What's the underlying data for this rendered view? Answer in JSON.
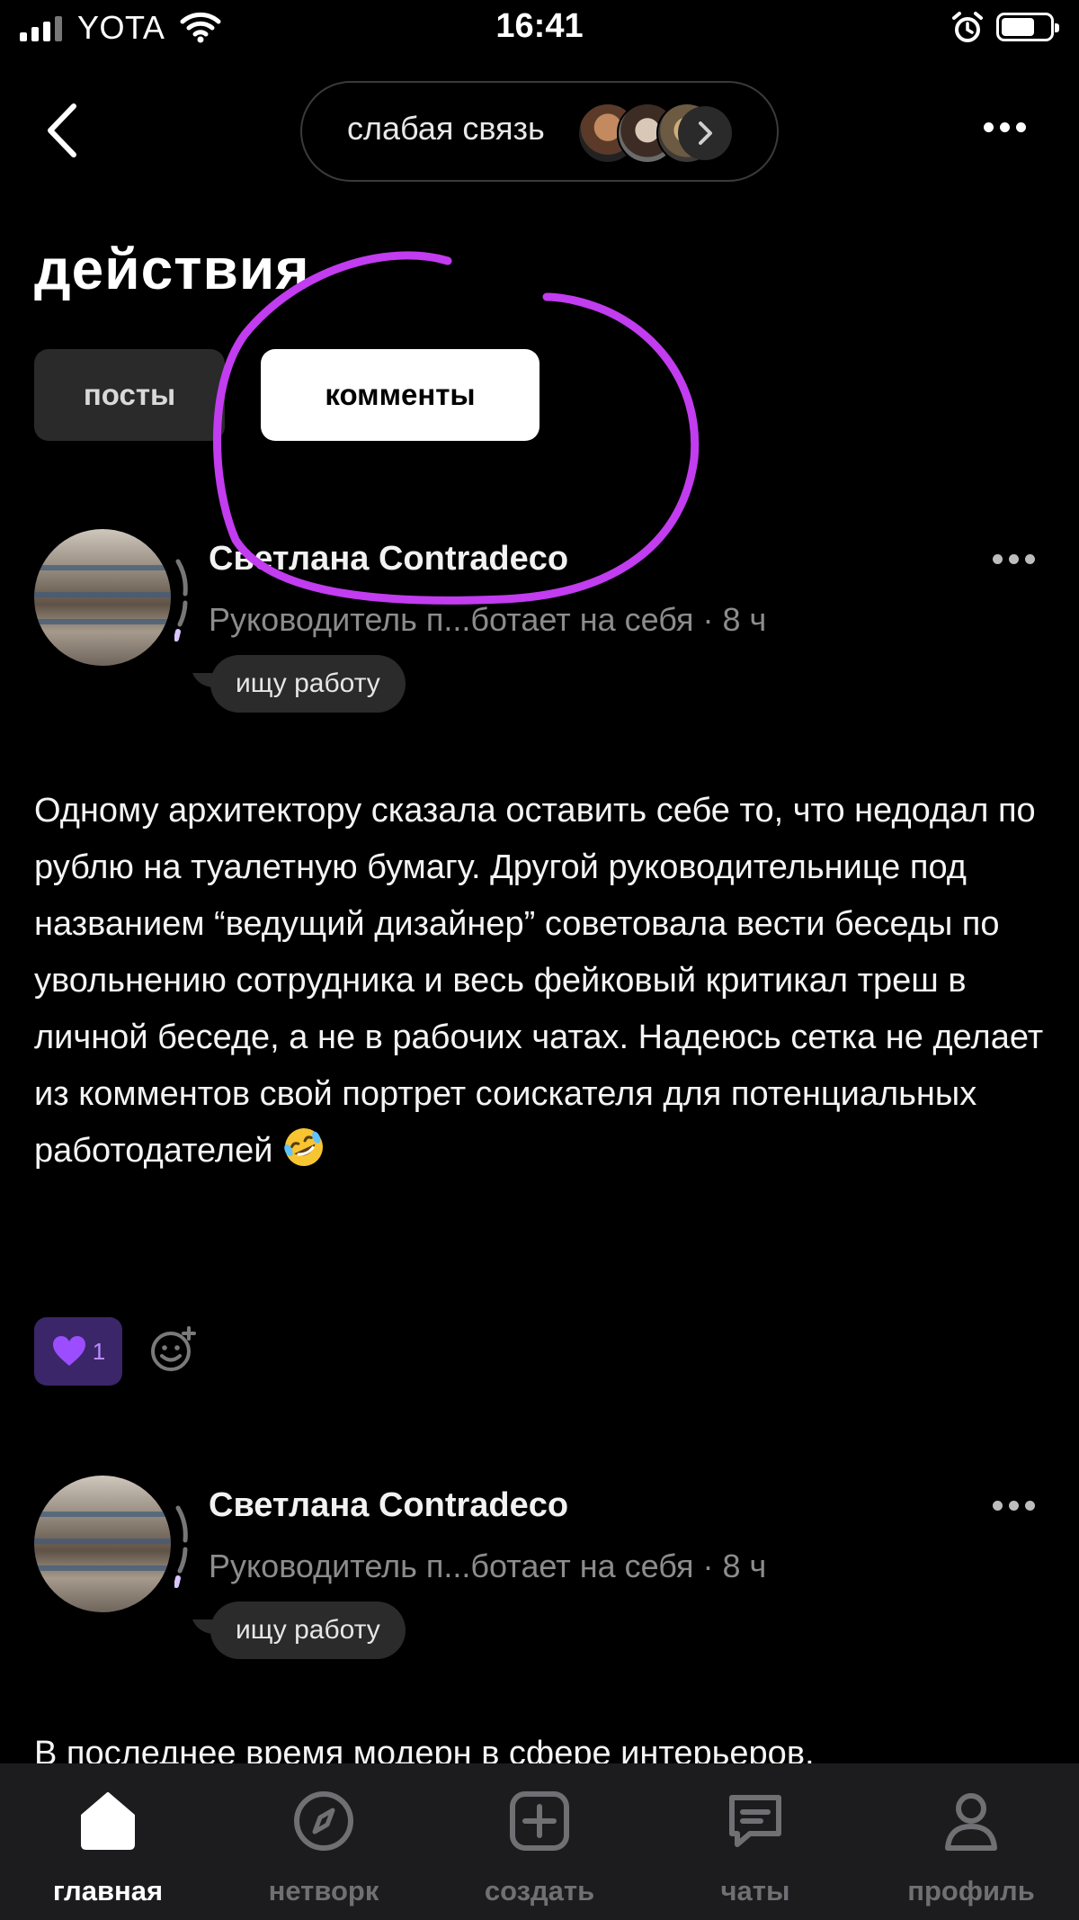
{
  "status_bar": {
    "carrier": "YOTA",
    "time": "16:41",
    "icons": [
      "signal-icon",
      "wifi-icon",
      "alarm-icon",
      "battery-icon"
    ]
  },
  "header": {
    "back_icon": "chevron-left-icon",
    "group_name": "слабая связь",
    "more_icon": "more-horizontal-icon"
  },
  "page": {
    "title": "действия",
    "tabs": [
      {
        "label": "посты",
        "active": false
      },
      {
        "label": "комменты",
        "active": true
      }
    ],
    "highlight_color": "#c23cf0"
  },
  "posts": [
    {
      "author": "Светлана Contradeco",
      "subtitle": "Руководитель п...ботает на себя · 8 ч",
      "badge": "ищу работу",
      "text": "Одному архитектору сказала оставить себе то, что недодал по рублю на туалетную бумагу. Другой руководительнице под названием “ведущий дизайнер” советовала вести беседы по увольнению сотрудника и весь фейковый критикал треш в личной беседе, а не в рабочих чатах. Надеюсь сетка не делает из комментов свой портрет соискателя для потенциальных работодателей",
      "emoji_icon": "rolling-on-floor-laughing-emoji",
      "likes": "1",
      "like_icon": "purple-heart-icon",
      "react_icon": "add-reaction-icon"
    },
    {
      "author": "Светлана Contradeco",
      "subtitle": "Руководитель п...ботает на себя · 8 ч",
      "badge": "ищу работу",
      "text": "В последнее время модерн в сфере интерьеров,"
    }
  ],
  "bottom_nav": [
    {
      "label": "главная",
      "icon": "home-icon",
      "active": true
    },
    {
      "label": "нетворк",
      "icon": "compass-icon",
      "active": false
    },
    {
      "label": "создать",
      "icon": "plus-square-icon",
      "active": false
    },
    {
      "label": "чаты",
      "icon": "chat-icon",
      "active": false
    },
    {
      "label": "профиль",
      "icon": "user-icon",
      "active": false
    }
  ],
  "colors": {
    "background": "#000000",
    "nav_background": "#1c1c1e",
    "like_background": "#3a2669",
    "accent_purple": "#b88cff"
  }
}
